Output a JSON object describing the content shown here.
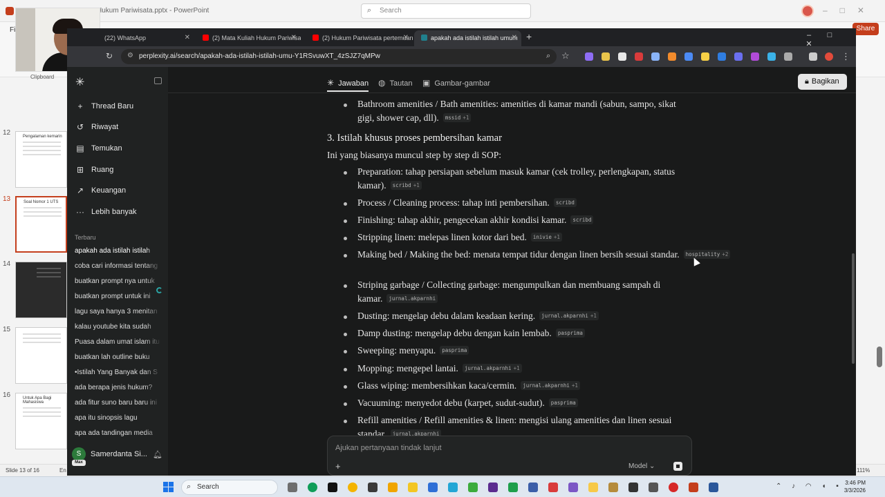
{
  "powerpoint": {
    "title": "Hukum Pariwisata.pptx - PowerPoint",
    "search_placeholder": "Search",
    "file_tab": "Fi",
    "share_label": "Share",
    "clipboard_label": "Clipboard",
    "slides": [
      {
        "number": "12",
        "title": "Pengalaman kemarin"
      },
      {
        "number": "13",
        "title": "Soal Nomor 1 UTS"
      },
      {
        "number": "14",
        "title": ""
      },
      {
        "number": "15",
        "title": ""
      },
      {
        "number": "16",
        "title": "Untuk Apa Bagi Mahasiswa"
      }
    ],
    "status": {
      "slide_info": "Slide 13 of 16",
      "lang": "En",
      "zoom": "111%"
    }
  },
  "browser": {
    "tabs": [
      {
        "label": "(22) WhatsApp",
        "favicon_color": "#25d366"
      },
      {
        "label": "(2) Mata Kuliah Hukum Pariwisata",
        "favicon_color": "#ff0000"
      },
      {
        "label": "(2) Hukum Pariwisata pertemuan",
        "favicon_color": "#ff0000"
      },
      {
        "label": "apakah ada istilah istilah umum",
        "favicon_color": "#20808d"
      }
    ],
    "url": "perplexity.ai/search/apakah-ada-istilah-istilah-umu-Y1RSvuwXT_4zSJZ7qMPw"
  },
  "sidebar": {
    "nav": [
      {
        "icon": "plus-icon",
        "label": "Thread Baru"
      },
      {
        "icon": "history-icon",
        "label": "Riwayat"
      },
      {
        "icon": "discover-icon",
        "label": "Temukan"
      },
      {
        "icon": "spaces-icon",
        "label": "Ruang"
      },
      {
        "icon": "finance-icon",
        "label": "Keuangan"
      },
      {
        "icon": "more-icon",
        "label": "Lebih banyak"
      }
    ],
    "recent_heading": "Terbaru",
    "recent": [
      "apakah ada istilah istilah",
      "coba cari informasi tentang",
      "buatkan prompt nya untuk",
      "buatkan prompt untuk ini",
      "lagu saya hanya 3 menitan",
      "kalau youtube kita sudah",
      "Puasa dalam umat islam itu",
      "buatkan lah outline buku",
      "•Istilah Yang Banyak dan S",
      "ada berapa jenis hukum?",
      "ada fitur suno baru baru ini",
      "apa itu sinopsis lagu",
      "apa ada tandingan media"
    ],
    "user": {
      "initial": "S",
      "name": "Samerdanta Si...",
      "badge": "Max"
    }
  },
  "content": {
    "tabs": [
      {
        "icon": "answer-icon",
        "label": "Jawaban"
      },
      {
        "icon": "globe-icon",
        "label": "Tautan"
      },
      {
        "icon": "image-icon",
        "label": "Gambar-gambar"
      }
    ],
    "share_label": "Bagikan",
    "prev_item": {
      "line1": "Bathroom amenities / Bath amenities: amenities di kamar mandi (sabun, sampo, sikat",
      "line2": "gigi, shower cap, dll).",
      "source": "mssid",
      "plus": "+1"
    },
    "section_heading": "3. Istilah khusus proses pembersihan kamar",
    "intro": "Ini yang biasanya muncul step by step di SOP:",
    "items": [
      {
        "line1": "Preparation: tahap persiapan sebelum masuk kamar (cek trolley, perlengkapan, status",
        "line2": "kamar).",
        "source": "scribd",
        "plus": "+1"
      },
      {
        "line1": "Process / Cleaning process: tahap inti pembersihan.",
        "line2": "",
        "source": "scribd",
        "plus": ""
      },
      {
        "line1": "Finishing: tahap akhir, pengecekan akhir kondisi kamar.",
        "line2": "",
        "source": "scribd",
        "plus": ""
      },
      {
        "line1": "Stripping linen: melepas linen kotor dari bed.",
        "line2": "",
        "source": "inivie",
        "plus": "+1"
      },
      {
        "line1": "Making bed / Making the bed: menata tempat tidur dengan linen bersih sesuai standar.",
        "line2": "",
        "source": "hospitality",
        "plus": "+2"
      },
      {
        "line1": "Striping garbage / Collecting garbage: mengumpulkan dan membuang sampah di",
        "line2": "kamar.",
        "source": "jurnal.akparnhi",
        "plus": ""
      },
      {
        "line1": "Dusting: mengelap debu dalam keadaan kering.",
        "line2": "",
        "source": "jurnal.akparnhi",
        "plus": "+1"
      },
      {
        "line1": "Damp dusting: mengelap debu dengan kain lembab.",
        "line2": "",
        "source": "pasprima",
        "plus": ""
      },
      {
        "line1": "Sweeping: menyapu.",
        "line2": "",
        "source": "pasprima",
        "plus": ""
      },
      {
        "line1": "Mopping: mengepel lantai.",
        "line2": "",
        "source": "jurnal.akparnhi",
        "plus": "+1"
      },
      {
        "line1": "Glass wiping: membersihkan kaca/cermin.",
        "line2": "",
        "source": "jurnal.akparnhi",
        "plus": "+1"
      },
      {
        "line1": "Vacuuming: menyedot debu (karpet, sudut-sudut).",
        "line2": "",
        "source": "pasprima",
        "plus": ""
      },
      {
        "line1": "Refill amenities / Refill amenities & linen: mengisi ulang amenities dan linen sesuai",
        "line2": "standar.",
        "source": "jurnal.akparnhi",
        "plus": ""
      }
    ],
    "followup_placeholder": "Ajukan pertanyaan tindak lanjut",
    "model_label": "Model"
  },
  "taskbar": {
    "search_label": "Search",
    "time": "3:46 PM",
    "date": "3/3/2026"
  }
}
